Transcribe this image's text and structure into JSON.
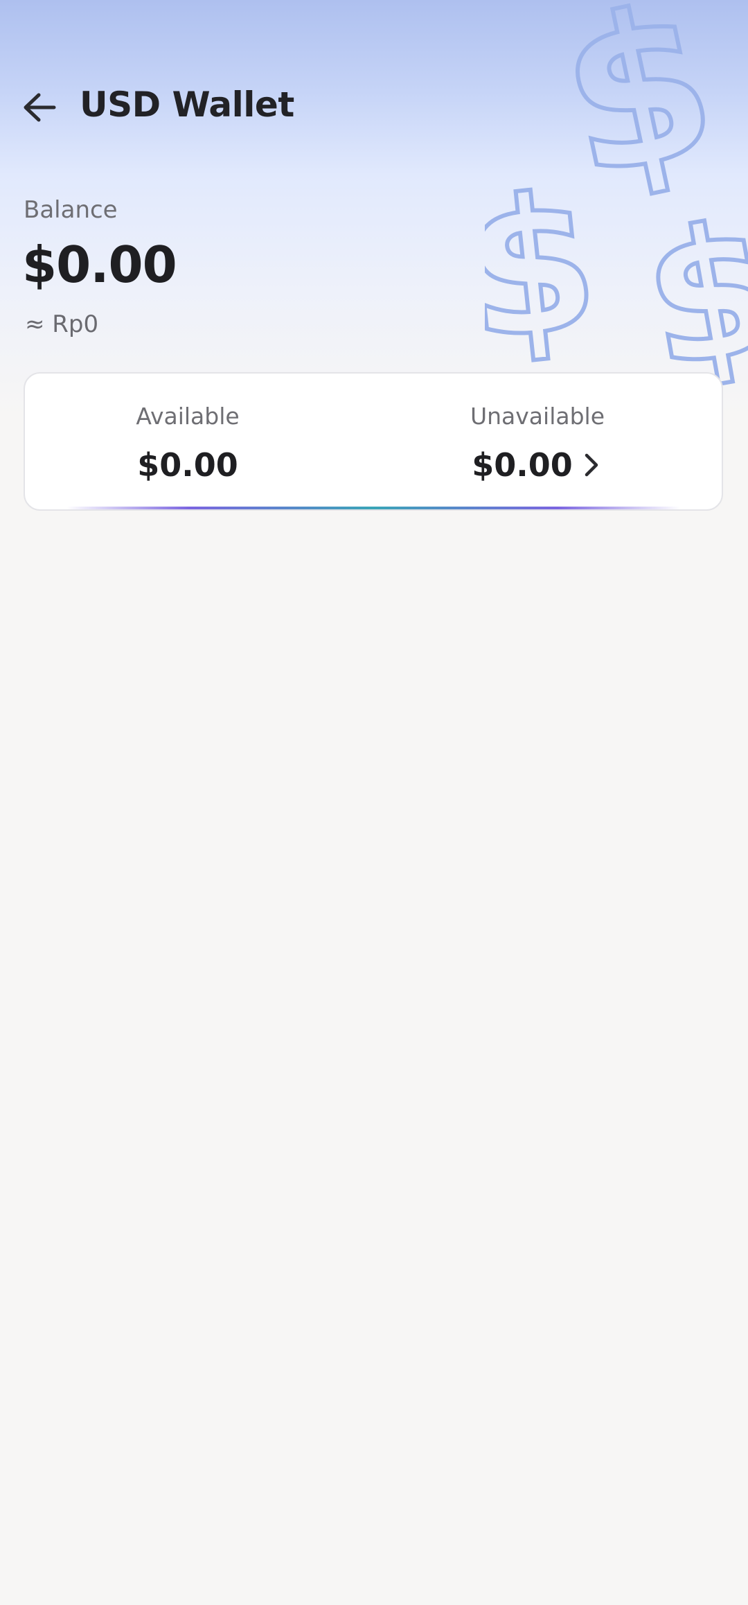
{
  "header": {
    "title": "USD Wallet",
    "back_icon": "arrow-left-icon"
  },
  "balance": {
    "label": "Balance",
    "value": "$0.00",
    "approx": "≈ Rp0"
  },
  "summary_card": {
    "available": {
      "label": "Available",
      "value": "$0.00"
    },
    "unavailable": {
      "label": "Unavailable",
      "value": "$0.00",
      "icon": "chevron-right-icon"
    }
  },
  "decoration": {
    "icon": "dollar-sign-icon"
  },
  "colors": {
    "hero_top": "#aec0ef",
    "background": "#f7f6f5",
    "accent_purple": "#7b65e0",
    "accent_teal": "#3aa5b7"
  }
}
